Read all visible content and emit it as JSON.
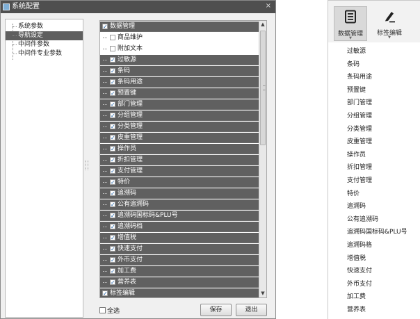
{
  "window": {
    "title": "系统配置",
    "close_glyph": "×"
  },
  "left_tree": {
    "items": [
      {
        "label": "系统参数",
        "selected": false
      },
      {
        "label": "导航设定",
        "selected": true
      },
      {
        "label": "中间件参数",
        "selected": false
      },
      {
        "label": "中间件专业参数",
        "selected": false
      }
    ]
  },
  "tree_list": {
    "items": [
      {
        "label": "数据管理",
        "checked": true,
        "level": 0,
        "highlighted": true
      },
      {
        "label": "商品维护",
        "checked": false,
        "level": 1,
        "highlighted": false
      },
      {
        "label": "附加文本",
        "checked": false,
        "level": 1,
        "highlighted": false
      },
      {
        "label": "过敏源",
        "checked": true,
        "level": 1,
        "highlighted": true
      },
      {
        "label": "条码",
        "checked": true,
        "level": 1,
        "highlighted": true
      },
      {
        "label": "条码用途",
        "checked": true,
        "level": 1,
        "highlighted": true
      },
      {
        "label": "预置键",
        "checked": true,
        "level": 1,
        "highlighted": true
      },
      {
        "label": "部门管理",
        "checked": true,
        "level": 1,
        "highlighted": true
      },
      {
        "label": "分组管理",
        "checked": true,
        "level": 1,
        "highlighted": true
      },
      {
        "label": "分类管理",
        "checked": true,
        "level": 1,
        "highlighted": true
      },
      {
        "label": "皮重管理",
        "checked": true,
        "level": 1,
        "highlighted": true
      },
      {
        "label": "操作员",
        "checked": true,
        "level": 1,
        "highlighted": true
      },
      {
        "label": "折扣管理",
        "checked": true,
        "level": 1,
        "highlighted": true
      },
      {
        "label": "支付管理",
        "checked": true,
        "level": 1,
        "highlighted": true
      },
      {
        "label": "特价",
        "checked": true,
        "level": 1,
        "highlighted": true
      },
      {
        "label": "追溯码",
        "checked": true,
        "level": 1,
        "highlighted": true
      },
      {
        "label": "公有追溯码",
        "checked": true,
        "level": 1,
        "highlighted": true
      },
      {
        "label": "追溯码国标码&PLU号",
        "checked": true,
        "level": 1,
        "highlighted": true
      },
      {
        "label": "追溯码档",
        "checked": true,
        "level": 1,
        "highlighted": true
      },
      {
        "label": "增值税",
        "checked": true,
        "level": 1,
        "highlighted": true
      },
      {
        "label": "快速支付",
        "checked": true,
        "level": 1,
        "highlighted": true
      },
      {
        "label": "外币支付",
        "checked": true,
        "level": 1,
        "highlighted": true
      },
      {
        "label": "加工费",
        "checked": true,
        "level": 1,
        "highlighted": true
      },
      {
        "label": "营养表",
        "checked": true,
        "level": 1,
        "highlighted": true
      },
      {
        "label": "标签编辑",
        "checked": true,
        "level": 0,
        "highlighted": true
      }
    ],
    "scroll": {
      "up_glyph": "▲",
      "down_glyph": "▼"
    }
  },
  "footer": {
    "select_all_label": "全选",
    "select_all_checked": false,
    "save_label": "保存",
    "exit_label": "退出"
  },
  "preview": {
    "ribbon_tabs": [
      {
        "label": "数据管理",
        "icon": "data-management-icon",
        "active": true
      },
      {
        "label": "标签编辑",
        "icon": "pen-icon",
        "active": false
      }
    ],
    "menu_items": [
      "过敏源",
      "条码",
      "条码用途",
      "预置键",
      "部门管理",
      "分组管理",
      "分类管理",
      "皮重管理",
      "操作员",
      "折扣管理",
      "支付管理",
      "特价",
      "追溯码",
      "公有追溯码",
      "追溯码国标码&PLU号",
      "追溯码格",
      "增值税",
      "快速支付",
      "外币支付",
      "加工费",
      "营养表"
    ]
  },
  "colors": {
    "titlebar": "#4f4f4f",
    "highlight_row": "#606060",
    "selected_tree_item": "#5f5f5f"
  }
}
